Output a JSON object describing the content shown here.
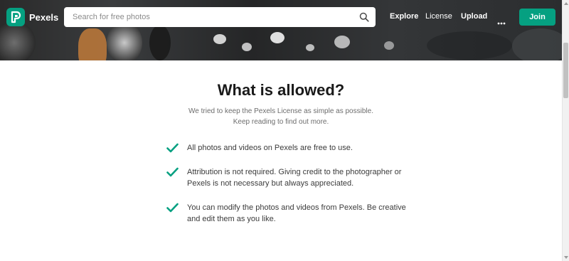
{
  "header": {
    "brand": "Pexels",
    "search_placeholder": "Search for free photos",
    "nav": {
      "explore": "Explore",
      "license": "License",
      "upload": "Upload",
      "more": "···",
      "join": "Join"
    }
  },
  "main": {
    "title": "What is allowed?",
    "subtitle_lines": [
      "We tried to keep the Pexels License as simple as possible.",
      "Keep reading to find out more."
    ],
    "allowed_items": [
      "All photos and videos on Pexels are free to use.",
      "Attribution is not required. Giving credit to the photographer or Pexels is not necessary but always appreciated.",
      "You can modify the photos and videos from Pexels. Be creative and edit them as you like."
    ]
  },
  "colors": {
    "brand_green": "#05a081",
    "check_green": "#05a081"
  },
  "icons": {
    "logo": "pexels-logo-icon",
    "search": "search-icon",
    "more": "more-dots-icon",
    "check": "checkmark-icon"
  }
}
